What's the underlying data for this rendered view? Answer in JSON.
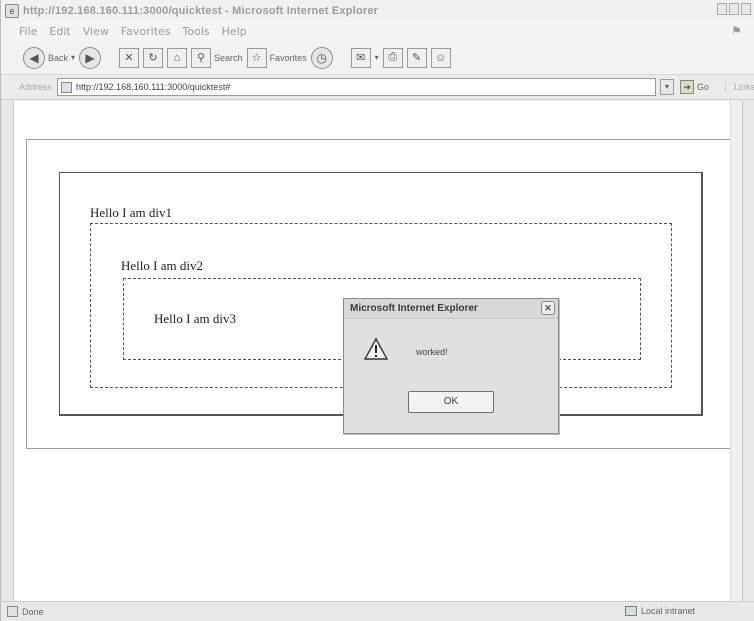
{
  "window": {
    "title": "http://192.168.160.111:3000/quicktest - Microsoft Internet Explorer"
  },
  "menu": [
    "File",
    "Edit",
    "View",
    "Favorites",
    "Tools",
    "Help"
  ],
  "toolbar": {
    "back_label": "Back",
    "search_label": "Search",
    "favorites_label": "Favorites"
  },
  "address": {
    "label": "Address",
    "url": "http://192.168.160.111:3000/quicktest#",
    "go_label": "Go",
    "links_label": "Links"
  },
  "page": {
    "div1_text": "Hello I am div1",
    "div2_text": "Hello I am div2",
    "div3_text": "Hello I am div3"
  },
  "dialog": {
    "title": "Microsoft Internet Explorer",
    "message": "worked!",
    "ok_label": "OK"
  },
  "status": {
    "text": "Done",
    "zone": "Local intranet"
  }
}
